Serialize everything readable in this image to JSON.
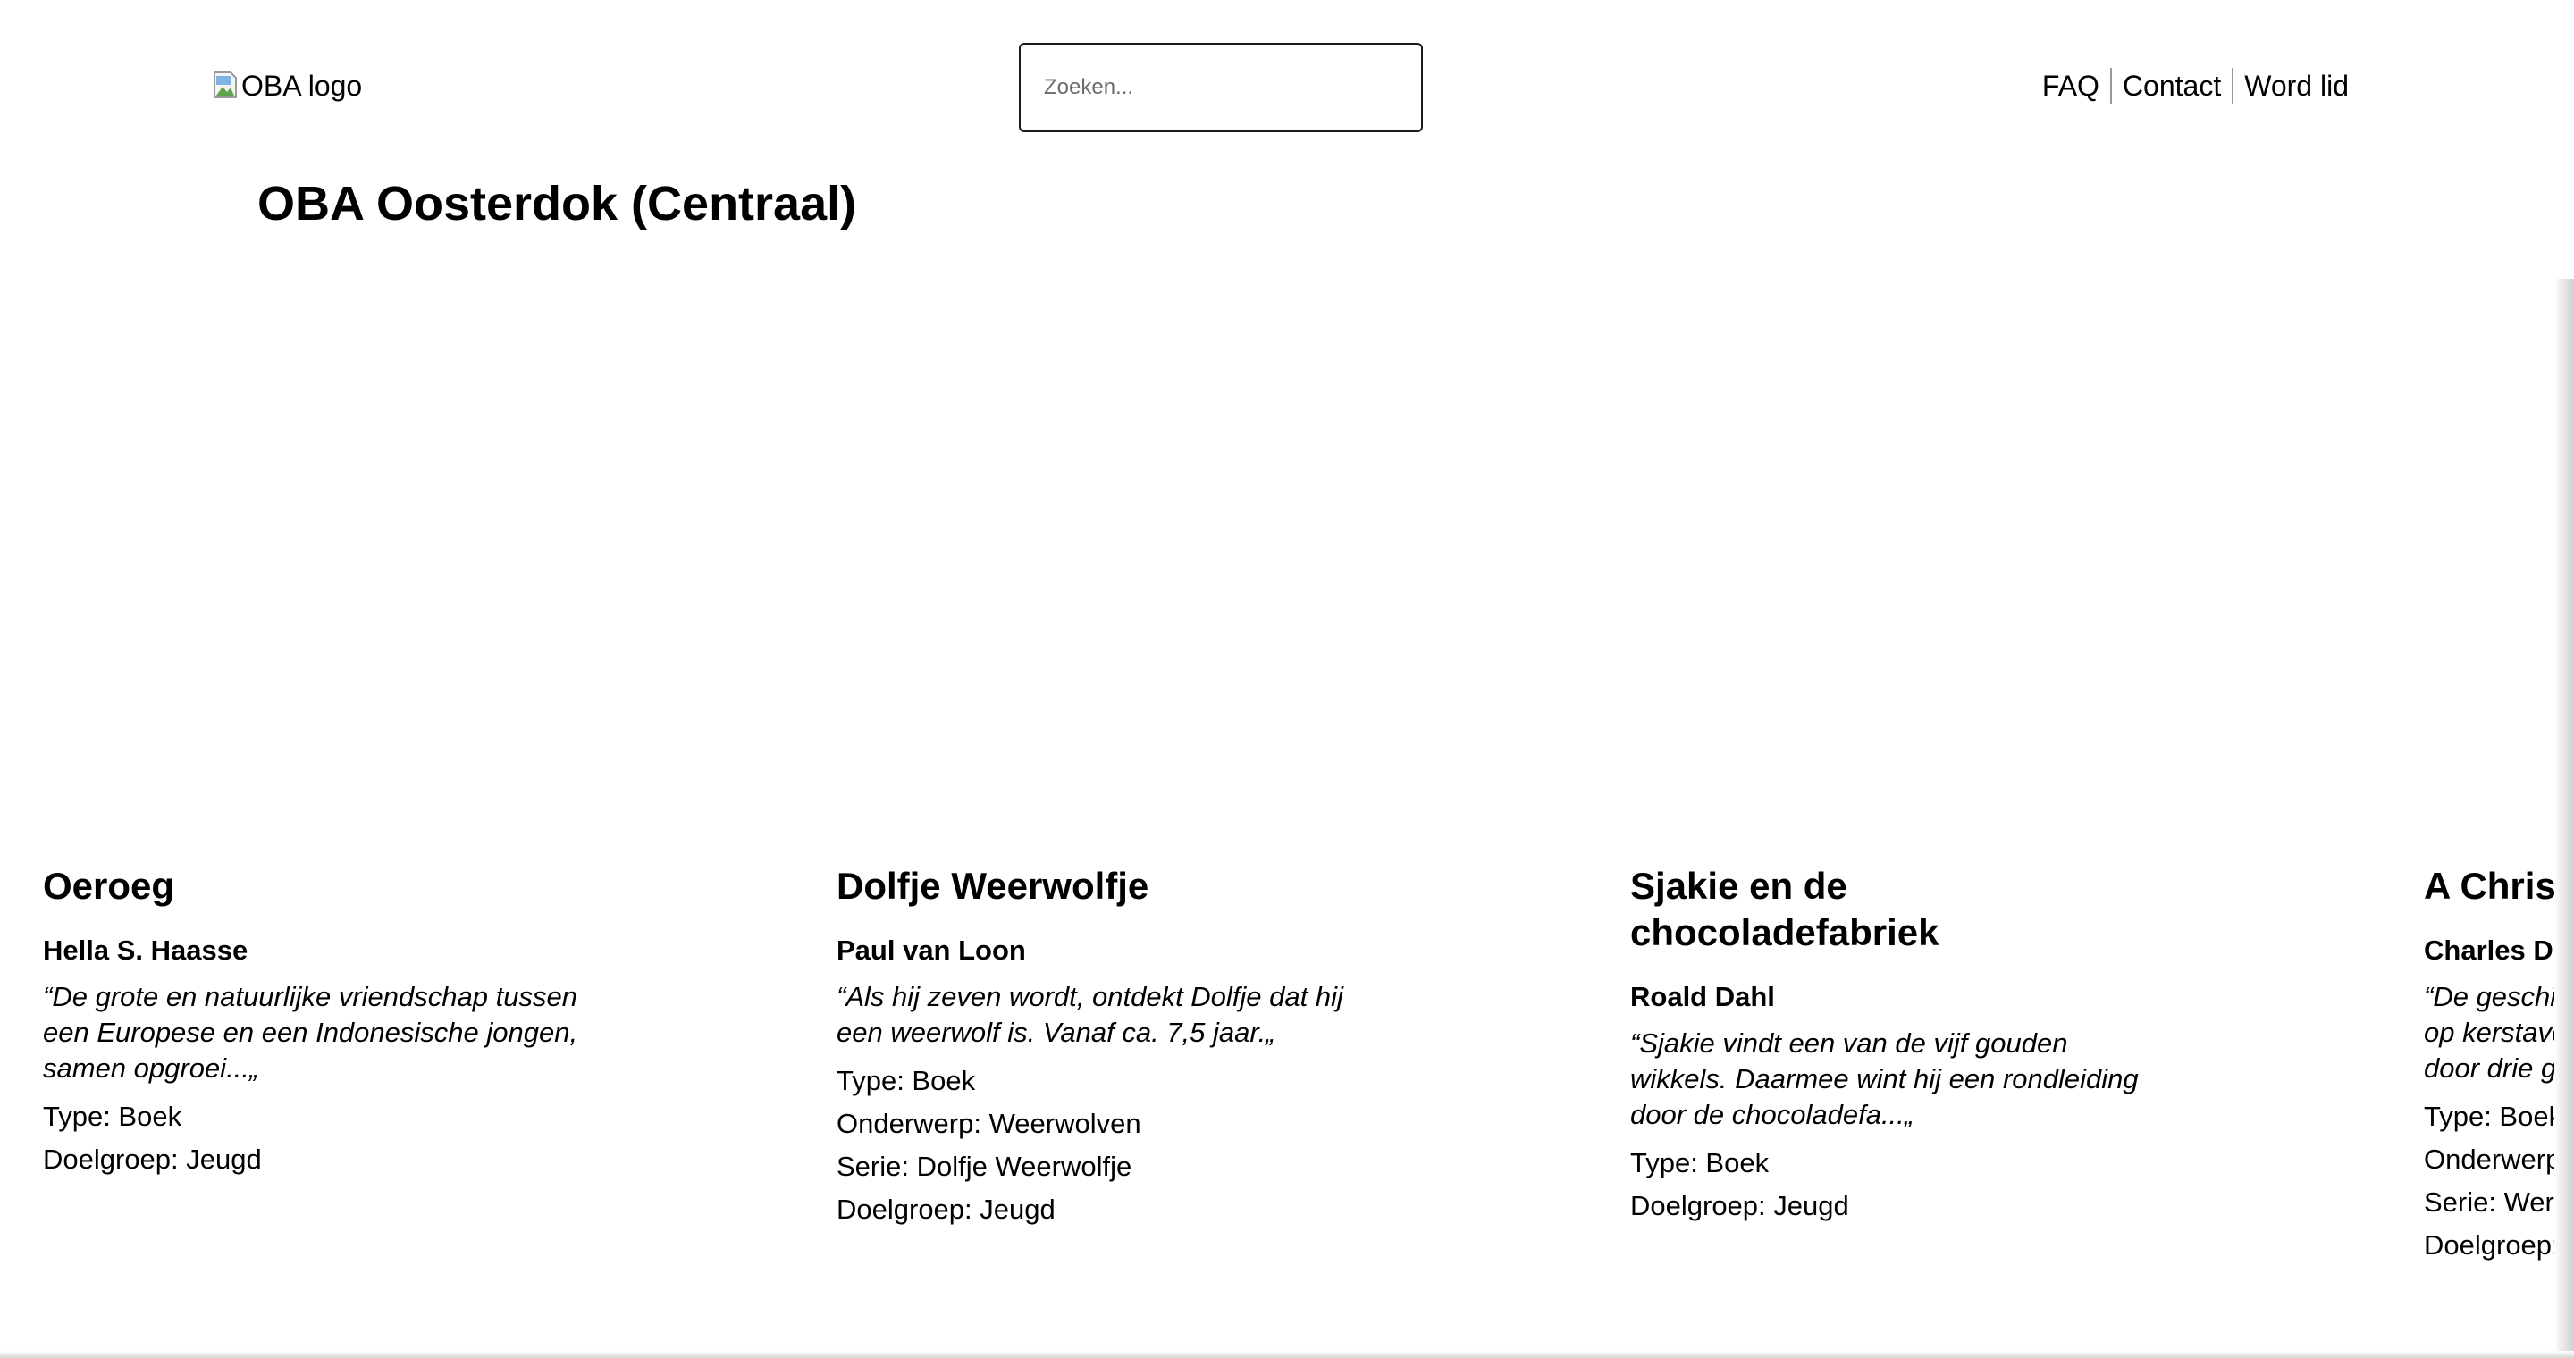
{
  "header": {
    "logo_alt": "OBA logo",
    "search_placeholder": "Zoeken...",
    "nav": [
      "FAQ",
      "Contact",
      "Word lid"
    ],
    "page_title": "OBA Oosterdok (Centraal)"
  },
  "cards": [
    {
      "title": "Oeroeg",
      "author": "Hella S. Haasse",
      "description": "“De grote en natuurlijke vriendschap tussen een Europese en een Indonesische jongen, samen opgroei...„",
      "meta": [
        "Type: Boek",
        "Doelgroep: Jeugd"
      ]
    },
    {
      "title": "Dolfje Weerwolfje",
      "author": "Paul van Loon",
      "description": "“Als hij zeven wordt, ontdekt Dolfje dat hij een weerwolf is. Vanaf ca. 7,5 jaar.„",
      "meta": [
        "Type: Boek",
        "Onderwerp: Weerwolven",
        "Serie: Dolfje Weerwolfje",
        "Doelgroep: Jeugd"
      ]
    },
    {
      "title": "Sjakie en de chocoladefabriek",
      "author": "Roald Dahl",
      "description": "“Sjakie vindt een van de vijf gouden wikkels. Daarmee wint hij een rondleiding door de chocoladefa...„",
      "meta": [
        "Type: Boek",
        "Doelgroep: Jeugd"
      ]
    },
    {
      "title": "A Christ",
      "author": "Charles Dic",
      "description": "“De geschie op kerstavo door drie ge",
      "meta": [
        "Type: Boek",
        "Onderwerp:",
        "Serie: Were",
        "Doelgroep: "
      ]
    }
  ]
}
